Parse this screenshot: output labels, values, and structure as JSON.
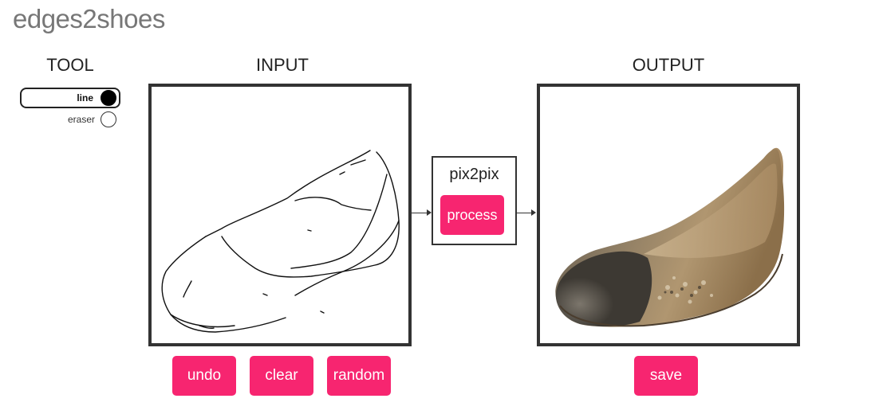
{
  "app": {
    "title": "edges2shoes"
  },
  "tool": {
    "heading": "TOOL",
    "options": [
      {
        "label": "line",
        "selected": true
      },
      {
        "label": "eraser",
        "selected": false
      }
    ]
  },
  "input": {
    "heading": "INPUT"
  },
  "model": {
    "name": "pix2pix",
    "process_label": "process"
  },
  "output": {
    "heading": "OUTPUT"
  },
  "actions": {
    "undo_label": "undo",
    "clear_label": "clear",
    "random_label": "random",
    "save_label": "save"
  },
  "colors": {
    "accent": "#f72570",
    "frame": "#333333",
    "title": "#777777"
  }
}
